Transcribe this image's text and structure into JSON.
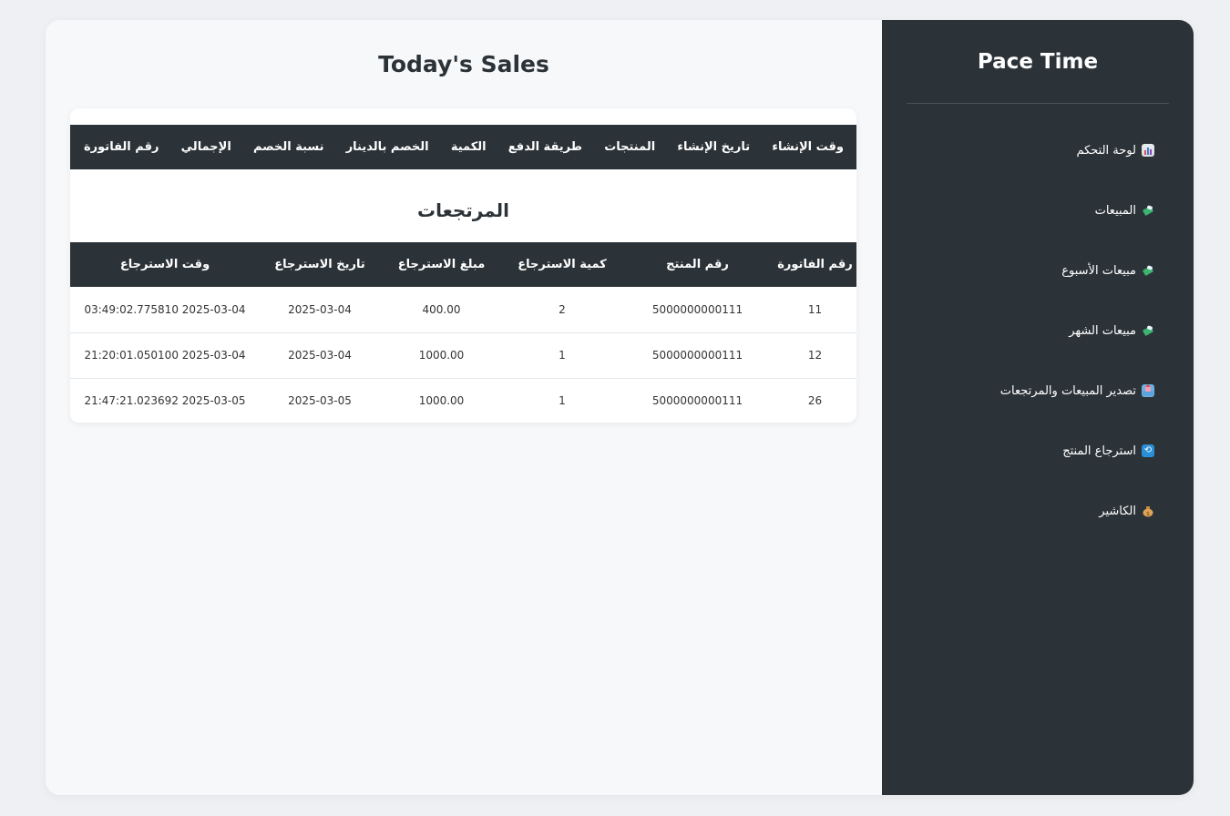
{
  "sidebar": {
    "brand": "Pace Time",
    "items": [
      {
        "label": "لوحة التحكم",
        "icon": "bar-chart-icon"
      },
      {
        "label": "المبيعات",
        "icon": "money-wings-icon"
      },
      {
        "label": "مبيعات الأسبوع",
        "icon": "money-wings-icon"
      },
      {
        "label": "مبيعات الشهر",
        "icon": "money-wings-icon"
      },
      {
        "label": "تصدير المبيعات والمرتجعات",
        "icon": "outbox-tray-icon"
      },
      {
        "label": "استرجاع المنتج",
        "icon": "arrows-sync-icon"
      },
      {
        "label": "الكاشير",
        "icon": "money-bag-icon"
      }
    ]
  },
  "main": {
    "title": "Today's Sales",
    "sales_table": {
      "headers": [
        "وقت الإنشاء",
        "تاريخ الإنشاء",
        "المنتجات",
        "طريقة الدفع",
        "الكمية",
        "الخصم بالدينار",
        "نسبة الخصم",
        "الإجمالي",
        "رقم الفاتورة"
      ]
    },
    "returns": {
      "title": "المرتجعات",
      "headers": [
        "رقم الفاتورة",
        "رقم المنتج",
        "كمية الاسترجاع",
        "مبلغ الاسترجاع",
        "تاريخ الاسترجاع",
        "وقت الاسترجاع"
      ],
      "rows": [
        [
          "11",
          "5000000000111",
          "2",
          "400.00",
          "2025-03-04",
          "2025-03-04 03:49:02.775810"
        ],
        [
          "12",
          "5000000000111",
          "1",
          "1000.00",
          "2025-03-04",
          "2025-03-04 21:20:01.050100"
        ],
        [
          "26",
          "5000000000111",
          "1",
          "1000.00",
          "2025-03-05",
          "2025-03-05 21:47:21.023692"
        ]
      ]
    }
  },
  "colors": {
    "sidebar_bg": "#2c3338",
    "page_bg": "#f7f8fa",
    "header_bg": "#2c3338"
  }
}
